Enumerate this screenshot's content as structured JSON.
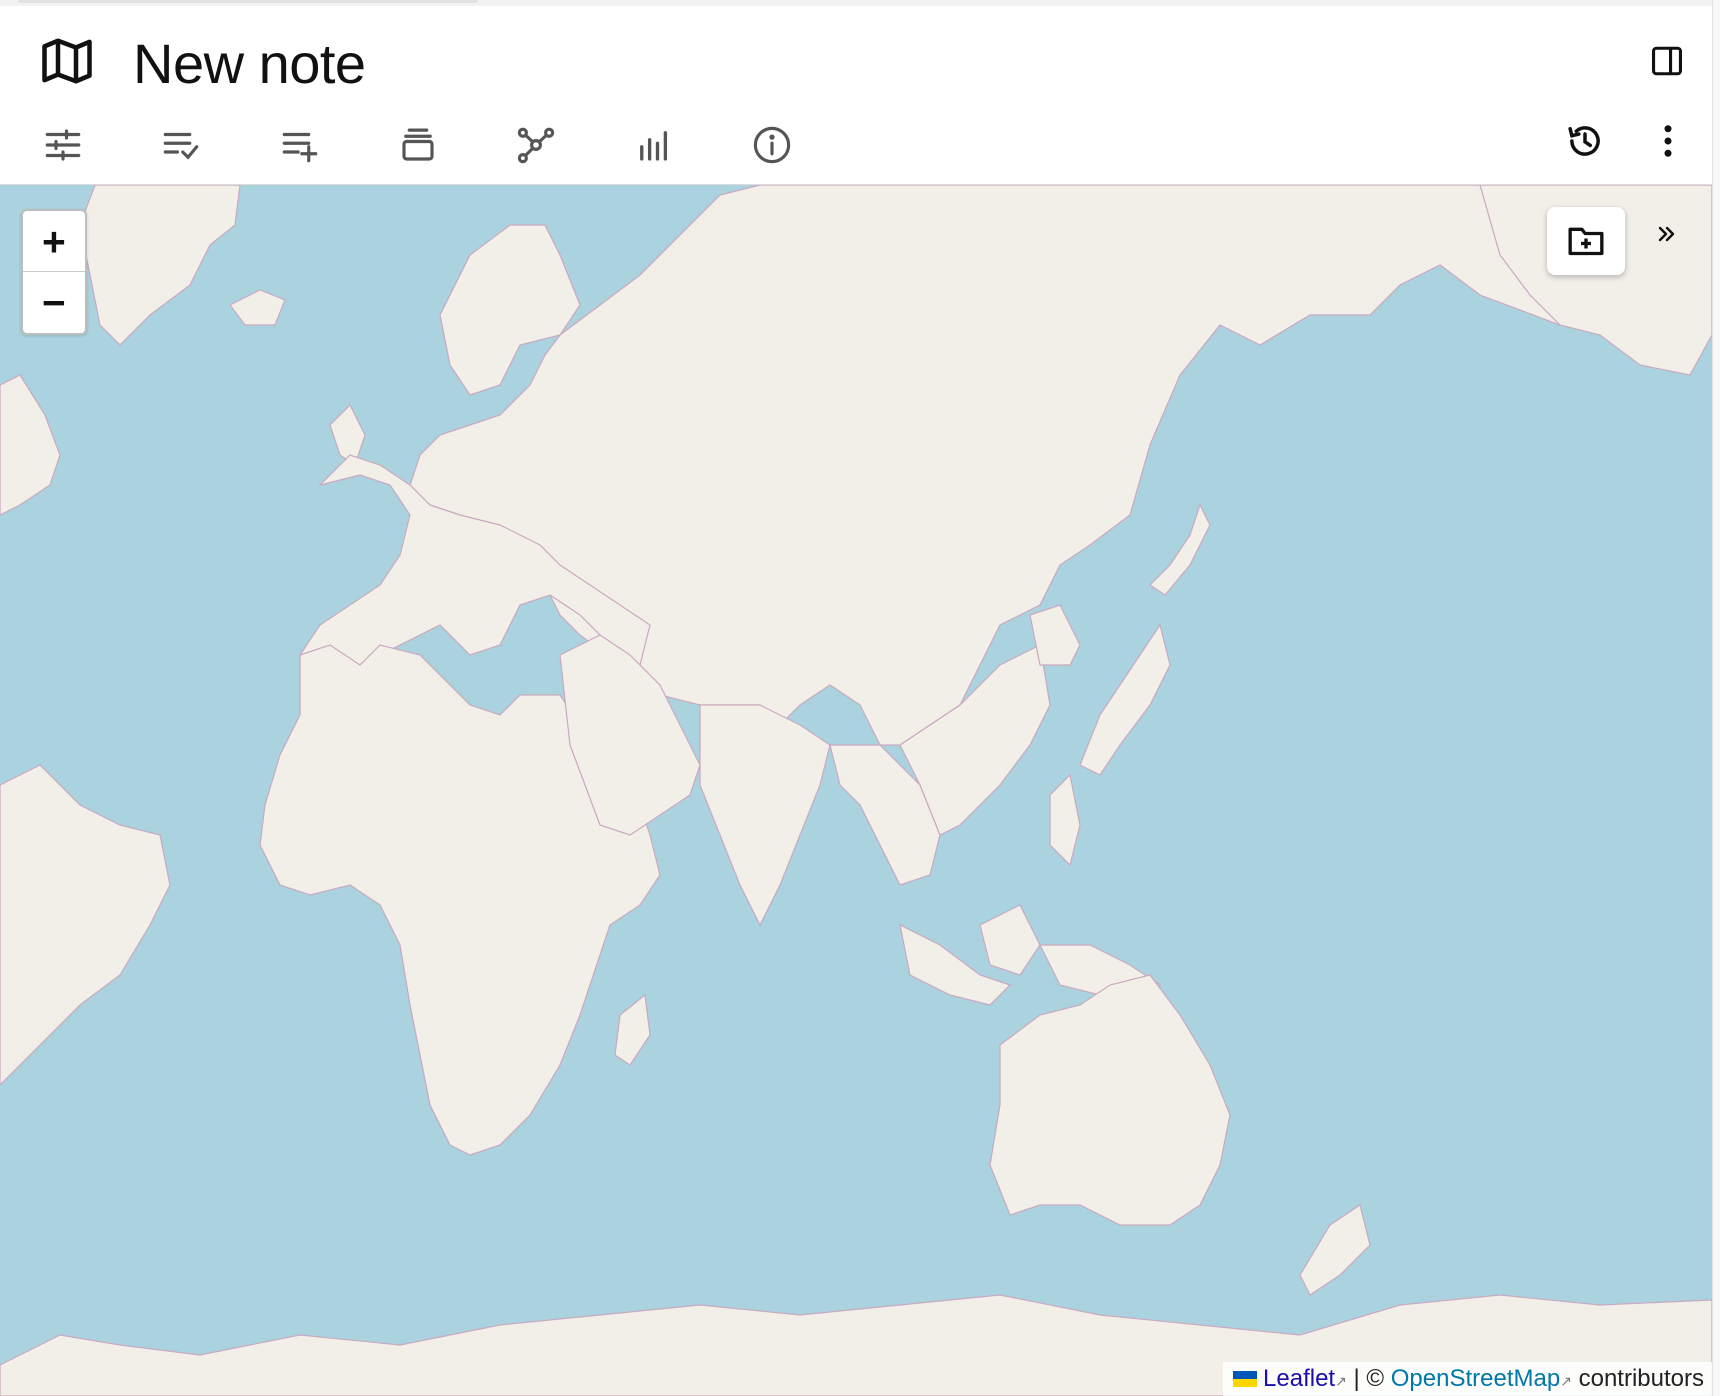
{
  "note": {
    "title": "New note",
    "type_icon": "map-icon"
  },
  "header": {
    "sidebar_toggle_icon": "sidebar-toggle-icon"
  },
  "toolbar": {
    "left_icons": [
      "settings-sliders-icon",
      "checklist-icon",
      "add-to-list-icon",
      "stack-icon",
      "graph-nodes-icon",
      "bar-chart-icon",
      "info-icon"
    ],
    "right_icons": [
      "history-icon",
      "more-vertical-icon"
    ]
  },
  "map": {
    "zoom_in_label": "+",
    "zoom_out_label": "−",
    "add_folder_icon": "folder-plus-icon",
    "expand_icon": "double-chevron-right-icon",
    "attribution": {
      "leaflet": "Leaflet",
      "separator": "|",
      "copyright": "©",
      "osm": "OpenStreetMap",
      "suffix": "contributors"
    },
    "colors": {
      "water": "#aad3df",
      "land": "#f2efe9",
      "border": "#c9a9c0"
    }
  }
}
